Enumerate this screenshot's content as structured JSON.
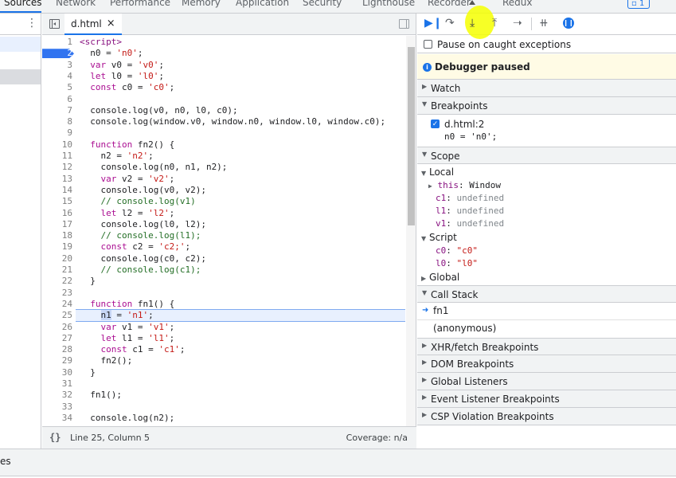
{
  "top_tabs": [
    "Sources",
    "Network",
    "Performance",
    "Memory",
    "Application",
    "Security",
    "Lighthouse",
    "Recorder",
    "Redux"
  ],
  "issues_count": "1",
  "editor": {
    "file_tab": "d.html",
    "close_glyph": "×",
    "cursor_position": "Line 25, Column 5",
    "coverage": "Coverage: n/a",
    "format_glyph": "{}"
  },
  "code_lines": [
    {
      "n": "1",
      "html": "<span class=\"tag\">&lt;script&gt;</span>"
    },
    {
      "n": "2",
      "html": "  n0 = <span class=\"str\">'n0'</span>;"
    },
    {
      "n": "3",
      "html": "  <span class=\"kw\">var</span> v0 = <span class=\"str\">'v0'</span>;"
    },
    {
      "n": "4",
      "html": "  <span class=\"kw\">let</span> l0 = <span class=\"str\">'l0'</span>;"
    },
    {
      "n": "5",
      "html": "  <span class=\"kw\">const</span> c0 = <span class=\"str\">'c0'</span>;"
    },
    {
      "n": "6",
      "html": ""
    },
    {
      "n": "7",
      "html": "  console.log(v0, n0, l0, c0);"
    },
    {
      "n": "8",
      "html": "  console.log(window.v0, window.n0, window.l0, window.c0);"
    },
    {
      "n": "9",
      "html": ""
    },
    {
      "n": "10",
      "html": "  <span class=\"kw\">function</span> fn2() {"
    },
    {
      "n": "11",
      "html": "    n2 = <span class=\"str\">'n2'</span>;"
    },
    {
      "n": "12",
      "html": "    console.log(n0, n1, n2);"
    },
    {
      "n": "13",
      "html": "    <span class=\"kw\">var</span> v2 = <span class=\"str\">'v2'</span>;"
    },
    {
      "n": "14",
      "html": "    console.log(v0, v2);"
    },
    {
      "n": "15",
      "html": "    <span class=\"cm\">// console.log(v1)</span>"
    },
    {
      "n": "16",
      "html": "    <span class=\"kw\">let</span> l2 = <span class=\"str\">'l2'</span>;"
    },
    {
      "n": "17",
      "html": "    console.log(l0, l2);"
    },
    {
      "n": "18",
      "html": "    <span class=\"cm\">// console.log(l1);</span>"
    },
    {
      "n": "19",
      "html": "    <span class=\"kw\">const</span> c2 = <span class=\"str\">'c2;'</span>;"
    },
    {
      "n": "20",
      "html": "    console.log(c0, c2);"
    },
    {
      "n": "21",
      "html": "    <span class=\"cm\">// console.log(c1);</span>"
    },
    {
      "n": "22",
      "html": "  }"
    },
    {
      "n": "23",
      "html": ""
    },
    {
      "n": "24",
      "html": "  <span class=\"kw\">function</span> fn1() {"
    },
    {
      "n": "25",
      "html": "    <span id=\"sel-n1\">n1</span> = <span class=\"str\">'n1'</span>;"
    },
    {
      "n": "26",
      "html": "    <span class=\"kw\">var</span> v1 = <span class=\"str\">'v1'</span>;"
    },
    {
      "n": "27",
      "html": "    <span class=\"kw\">let</span> l1 = <span class=\"str\">'l1'</span>;"
    },
    {
      "n": "28",
      "html": "    <span class=\"kw\">const</span> c1 = <span class=\"str\">'c1'</span>;"
    },
    {
      "n": "29",
      "html": "    fn2();"
    },
    {
      "n": "30",
      "html": "  }"
    },
    {
      "n": "31",
      "html": ""
    },
    {
      "n": "32",
      "html": "  fn1();"
    },
    {
      "n": "33",
      "html": ""
    },
    {
      "n": "34",
      "html": "  console.log(n2);"
    }
  ],
  "breakpoint_line": "2",
  "current_line": "25",
  "debugger": {
    "pause_on_caught": "Pause on caught exceptions",
    "paused_banner": "Debugger paused",
    "sections": {
      "watch": "Watch",
      "breakpoints": "Breakpoints",
      "scope": "Scope",
      "call_stack": "Call Stack",
      "xhr": "XHR/fetch Breakpoints",
      "dom": "DOM Breakpoints",
      "global_listeners": "Global Listeners",
      "event_listener": "Event Listener Breakpoints",
      "csp": "CSP Violation Breakpoints"
    },
    "breakpoint_item": {
      "file": "d.html:2",
      "code": "n0 = 'n0';"
    },
    "scope": {
      "local_label": "Local",
      "local": [
        {
          "name": "this",
          "value": "Window"
        },
        {
          "name": "c1",
          "value": "undefined"
        },
        {
          "name": "l1",
          "value": "undefined"
        },
        {
          "name": "v1",
          "value": "undefined"
        }
      ],
      "script_label": "Script",
      "script": [
        {
          "name": "c0",
          "value": "\"c0\""
        },
        {
          "name": "l0",
          "value": "\"l0\""
        }
      ],
      "global_label": "Global"
    },
    "call_stack": [
      "fn1",
      "(anonymous)"
    ]
  },
  "drawer_tab": "es",
  "colors": {
    "accent": "#1a73e8",
    "highlight": "#f6ff00",
    "paused_bg": "#fffbe5"
  }
}
